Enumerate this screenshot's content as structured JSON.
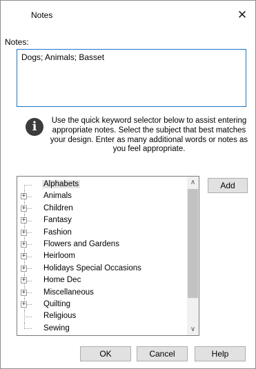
{
  "window": {
    "title": "Notes",
    "close_glyph": "✕"
  },
  "notes": {
    "label": "Notes:",
    "value": "Dogs;  Animals; Basset"
  },
  "info": {
    "icon": "i",
    "text": "Use the quick keyword selector below to assist entering appropriate notes. Select the subject that best matches your design. Enter as many additional words or notes as you feel appropriate."
  },
  "tree": {
    "items": [
      {
        "label": "Alphabets",
        "expandable": false,
        "selected": true
      },
      {
        "label": "Animals",
        "expandable": true
      },
      {
        "label": "Children",
        "expandable": true
      },
      {
        "label": "Fantasy",
        "expandable": true
      },
      {
        "label": "Fashion",
        "expandable": true
      },
      {
        "label": "Flowers and Gardens",
        "expandable": true
      },
      {
        "label": "Heirloom",
        "expandable": true
      },
      {
        "label": "Holidays Special Occasions",
        "expandable": true
      },
      {
        "label": "Home Dec",
        "expandable": true
      },
      {
        "label": "Miscellaneous",
        "expandable": true
      },
      {
        "label": "Quilting",
        "expandable": true
      },
      {
        "label": "Religious",
        "expandable": false
      },
      {
        "label": "Sewing",
        "expandable": false
      }
    ],
    "scroll_up_glyph": "∧",
    "scroll_down_glyph": "∨"
  },
  "buttons": {
    "add": "Add",
    "ok": "OK",
    "cancel": "Cancel",
    "help": "Help"
  },
  "colors": {
    "focus_border": "#1a75c9",
    "button_bg": "#e1e1e1",
    "info_icon_bg": "#3c3c3c"
  }
}
